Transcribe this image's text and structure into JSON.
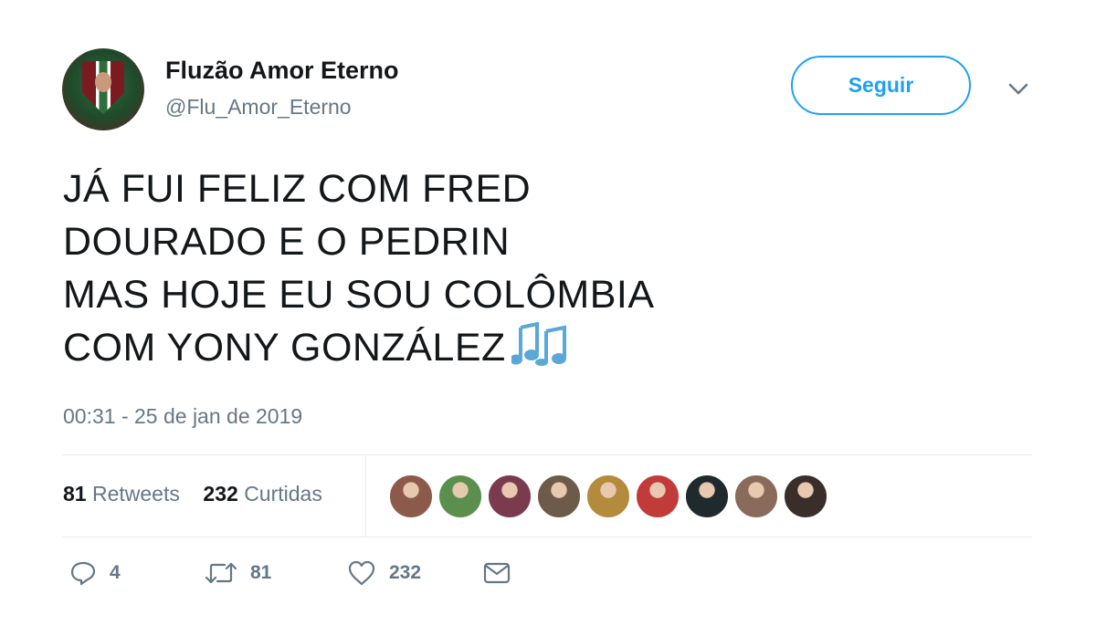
{
  "user": {
    "name": "Fluzão Amor Eterno",
    "handle": "@Flu_Amor_Eterno"
  },
  "follow_button": {
    "label": "Seguir"
  },
  "tweet": {
    "lines": [
      "JÁ FUI FELIZ COM FRED",
      "DOURADO E O PEDRIN",
      "MAS HOJE EU SOU COLÔMBIA",
      "COM YONY GONZÁLEZ"
    ],
    "emoji": "musical-notes",
    "timestamp": "00:31 - 25 de jan de 2019"
  },
  "stats": {
    "retweets_count": "81",
    "retweets_label": "Retweets",
    "likes_count": "232",
    "likes_label": "Curtidas"
  },
  "likers": [
    {
      "name": "liker-1",
      "color": "#8b5a4a"
    },
    {
      "name": "liker-2",
      "color": "#5a8f4e"
    },
    {
      "name": "liker-3",
      "color": "#7a3b4f"
    },
    {
      "name": "liker-4",
      "color": "#6e5a48"
    },
    {
      "name": "liker-5",
      "color": "#b48a3c"
    },
    {
      "name": "liker-6",
      "color": "#c23b3b"
    },
    {
      "name": "liker-7",
      "color": "#1e2a2e"
    },
    {
      "name": "liker-8",
      "color": "#8a6a5a"
    },
    {
      "name": "liker-9",
      "color": "#3a2e2a"
    }
  ],
  "actions": {
    "replies": "4",
    "retweets": "81",
    "likes": "232"
  },
  "colors": {
    "accent": "#1da1f2",
    "text": "#14171a",
    "secondary": "#657786",
    "divider": "#e6ecf0"
  }
}
